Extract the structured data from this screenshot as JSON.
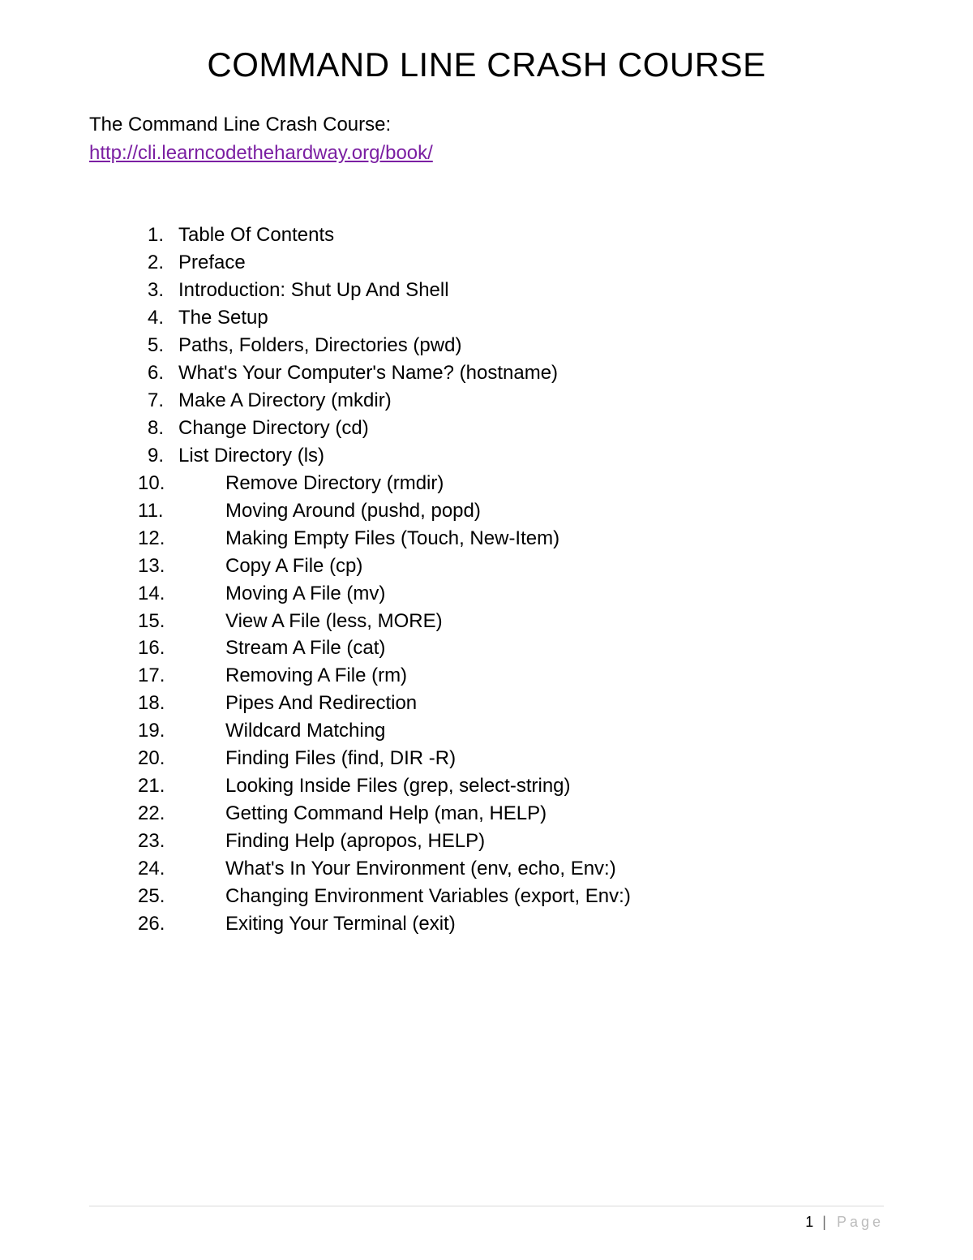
{
  "title": "COMMAND LINE CRASH COURSE",
  "intro_text": "The Command Line Crash Course:",
  "link_text": "http://cli.learncodethehardway.org/book/",
  "toc": [
    {
      "n": "1",
      "label": "Table Of Contents"
    },
    {
      "n": "2",
      "label": "Preface"
    },
    {
      "n": "3",
      "label": "Introduction: Shut Up And Shell"
    },
    {
      "n": "4",
      "label": "The Setup"
    },
    {
      "n": "5",
      "label": "Paths, Folders, Directories (pwd)"
    },
    {
      "n": "6",
      "label": "What's Your Computer's Name? (hostname)"
    },
    {
      "n": "7",
      "label": "Make A Directory (mkdir)"
    },
    {
      "n": "8",
      "label": "Change Directory (cd)"
    },
    {
      "n": "9",
      "label": "List Directory (ls)"
    },
    {
      "n": "10",
      "label": "Remove Directory (rmdir)"
    },
    {
      "n": "11",
      "label": "Moving Around (pushd, popd)"
    },
    {
      "n": "12",
      "label": "Making Empty Files (Touch, New-Item)"
    },
    {
      "n": "13",
      "label": "Copy A File (cp)"
    },
    {
      "n": "14",
      "label": "Moving A File (mv)"
    },
    {
      "n": "15",
      "label": "View A File (less, MORE)"
    },
    {
      "n": "16",
      "label": "Stream A File (cat)"
    },
    {
      "n": "17",
      "label": "Removing A File (rm)"
    },
    {
      "n": "18",
      "label": "Pipes And Redirection"
    },
    {
      "n": "19",
      "label": "Wildcard Matching"
    },
    {
      "n": "20",
      "label": "Finding Files (find, DIR -R)"
    },
    {
      "n": "21",
      "label": "Looking Inside Files (grep, select-string)"
    },
    {
      "n": "22",
      "label": "Getting Command Help (man, HELP)"
    },
    {
      "n": "23",
      "label": "Finding Help (apropos, HELP)"
    },
    {
      "n": "24",
      "label": "What's In Your Environment (env, echo, Env:)"
    },
    {
      "n": "25",
      "label": "Changing Environment Variables (export, Env:)"
    },
    {
      "n": "26",
      "label": "Exiting Your Terminal (exit)"
    }
  ],
  "footer": {
    "page_num": "1",
    "sep": "|",
    "page_label": "Page"
  }
}
